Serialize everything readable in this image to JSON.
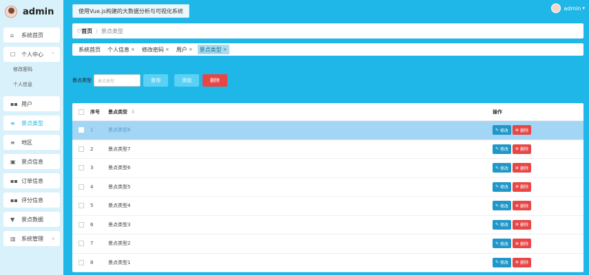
{
  "brand": {
    "title": "admin"
  },
  "header": {
    "title": "使用Vue.js构建的大数据分析与可视化系统"
  },
  "user": {
    "name": "admin",
    "dropdown": "▾"
  },
  "sidebar": {
    "items": [
      {
        "icon": "⌂",
        "label": "系统首页"
      },
      {
        "icon": "☐",
        "label": "个人中心",
        "chev": "^"
      },
      {
        "label": "修改密码"
      },
      {
        "label": "个人信息"
      },
      {
        "icon": "▪▪",
        "label": "用户"
      },
      {
        "icon": "≡",
        "label": "景点类型"
      },
      {
        "icon": "≡",
        "label": "地区"
      },
      {
        "icon": "▣",
        "label": "景点信息"
      },
      {
        "icon": "▪▪",
        "label": "订单信息"
      },
      {
        "icon": "▪▪",
        "label": "评分信息"
      },
      {
        "icon": "▼",
        "label": "景点数据"
      },
      {
        "icon": "▥",
        "label": "系统管理",
        "chev": "v"
      }
    ]
  },
  "breadcrumb": {
    "home": "♡首页",
    "sep": "/",
    "current": "景点类型"
  },
  "tags": [
    {
      "label": "系统首页"
    },
    {
      "label": "个人信息",
      "x": "×"
    },
    {
      "label": "修改密码",
      "x": "×"
    },
    {
      "label": "用户",
      "x": "×"
    },
    {
      "label": "景点类型",
      "x": "×"
    }
  ],
  "search": {
    "label": "景点类型",
    "placeholder": "景点类型",
    "query_label": "查询",
    "add_label": "添加",
    "delete_label": "删除"
  },
  "table": {
    "columns": {
      "no": "序号",
      "name": "景点类型",
      "sort": "⇕",
      "op": "操作"
    },
    "edit_label": "修改",
    "delete_label": "删除",
    "edit_icon": "✎",
    "delete_icon": "⊗",
    "rows": [
      {
        "no": "1",
        "name": "景点类型8"
      },
      {
        "no": "2",
        "name": "景点类型7"
      },
      {
        "no": "3",
        "name": "景点类型6"
      },
      {
        "no": "4",
        "name": "景点类型5"
      },
      {
        "no": "5",
        "name": "景点类型4"
      },
      {
        "no": "6",
        "name": "景点类型3"
      },
      {
        "no": "7",
        "name": "景点类型2"
      },
      {
        "no": "8",
        "name": "景点类型1"
      }
    ]
  }
}
